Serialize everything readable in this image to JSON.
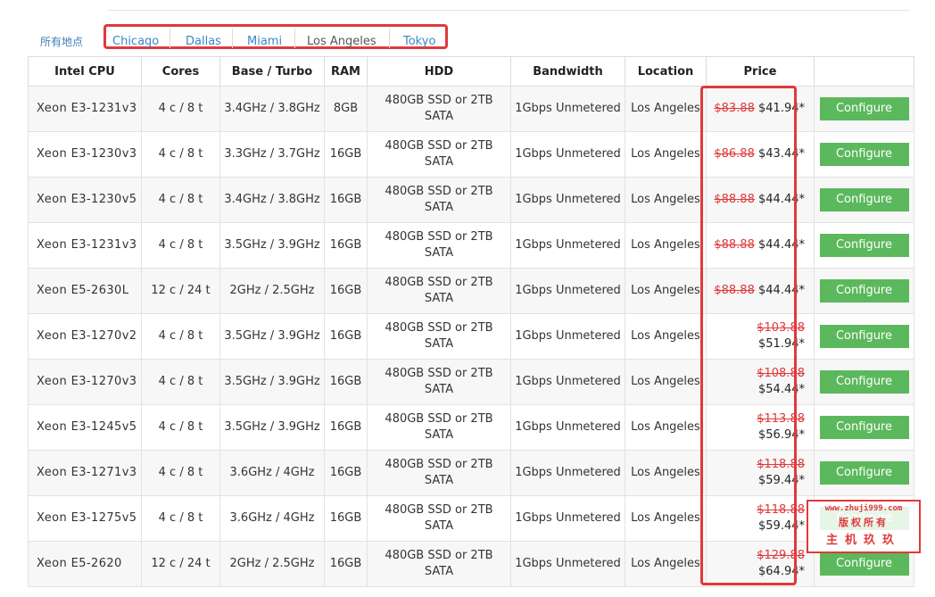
{
  "filters": {
    "all_label": "所有地点",
    "tabs": [
      {
        "label": "Chicago",
        "active": false
      },
      {
        "label": "Dallas",
        "active": false
      },
      {
        "label": "Miami",
        "active": false
      },
      {
        "label": "Los Angeles",
        "active": true
      },
      {
        "label": "Tokyo",
        "active": false
      }
    ]
  },
  "table": {
    "headers": [
      "Intel CPU",
      "Cores",
      "Base / Turbo",
      "RAM",
      "HDD",
      "Bandwidth",
      "Location",
      "Price",
      ""
    ],
    "configure_label": "Configure",
    "rows": [
      {
        "cpu": "Xeon E3-1231v3",
        "cores": "4 c / 8 t",
        "freq": "3.4GHz / 3.8GHz",
        "ram": "8GB",
        "hdd": "480GB SSD or 2TB SATA",
        "bw": "1Gbps Unmetered",
        "loc": "Los Angeles",
        "old_price": "$83.88",
        "new_price": "$41.94*"
      },
      {
        "cpu": "Xeon E3-1230v3",
        "cores": "4 c / 8 t",
        "freq": "3.3GHz / 3.7GHz",
        "ram": "16GB",
        "hdd": "480GB SSD or 2TB SATA",
        "bw": "1Gbps Unmetered",
        "loc": "Los Angeles",
        "old_price": "$86.88",
        "new_price": "$43.44*"
      },
      {
        "cpu": "Xeon E3-1230v5",
        "cores": "4 c / 8 t",
        "freq": "3.4GHz / 3.8GHz",
        "ram": "16GB",
        "hdd": "480GB SSD or 2TB SATA",
        "bw": "1Gbps Unmetered",
        "loc": "Los Angeles",
        "old_price": "$88.88",
        "new_price": "$44.44*"
      },
      {
        "cpu": "Xeon E3-1231v3",
        "cores": "4 c / 8 t",
        "freq": "3.5GHz / 3.9GHz",
        "ram": "16GB",
        "hdd": "480GB SSD or 2TB SATA",
        "bw": "1Gbps Unmetered",
        "loc": "Los Angeles",
        "old_price": "$88.88",
        "new_price": "$44.44*"
      },
      {
        "cpu": "Xeon E5-2630L",
        "cores": "12 c / 24 t",
        "freq": "2GHz / 2.5GHz",
        "ram": "16GB",
        "hdd": "480GB SSD or 2TB SATA",
        "bw": "1Gbps Unmetered",
        "loc": "Los Angeles",
        "old_price": "$88.88",
        "new_price": "$44.44*"
      },
      {
        "cpu": "Xeon E3-1270v2",
        "cores": "4 c / 8 t",
        "freq": "3.5GHz / 3.9GHz",
        "ram": "16GB",
        "hdd": "480GB SSD or 2TB SATA",
        "bw": "1Gbps Unmetered",
        "loc": "Los Angeles",
        "old_price": "$103.88",
        "new_price": "$51.94*"
      },
      {
        "cpu": "Xeon E3-1270v3",
        "cores": "4 c / 8 t",
        "freq": "3.5GHz / 3.9GHz",
        "ram": "16GB",
        "hdd": "480GB SSD or 2TB SATA",
        "bw": "1Gbps Unmetered",
        "loc": "Los Angeles",
        "old_price": "$108.88",
        "new_price": "$54.44*"
      },
      {
        "cpu": "Xeon E3-1245v5",
        "cores": "4 c / 8 t",
        "freq": "3.5GHz / 3.9GHz",
        "ram": "16GB",
        "hdd": "480GB SSD or 2TB SATA",
        "bw": "1Gbps Unmetered",
        "loc": "Los Angeles",
        "old_price": "$113.88",
        "new_price": "$56.94*"
      },
      {
        "cpu": "Xeon E3-1271v3",
        "cores": "4 c / 8 t",
        "freq": "3.6GHz / 4GHz",
        "ram": "16GB",
        "hdd": "480GB SSD or 2TB SATA",
        "bw": "1Gbps Unmetered",
        "loc": "Los Angeles",
        "old_price": "$118.88",
        "new_price": "$59.44*"
      },
      {
        "cpu": "Xeon E3-1275v5",
        "cores": "4 c / 8 t",
        "freq": "3.6GHz / 4GHz",
        "ram": "16GB",
        "hdd": "480GB SSD or 2TB SATA",
        "bw": "1Gbps Unmetered",
        "loc": "Los Angeles",
        "old_price": "$118.88",
        "new_price": "$59.44*"
      },
      {
        "cpu": "Xeon E5-2620",
        "cores": "12 c / 24 t",
        "freq": "2GHz / 2.5GHz",
        "ram": "16GB",
        "hdd": "480GB SSD or 2TB SATA",
        "bw": "1Gbps Unmetered",
        "loc": "Los Angeles",
        "old_price": "$129.88",
        "new_price": "$64.94*"
      }
    ]
  },
  "watermark": {
    "url": "www.zhuji999.com",
    "line2": "版权所有",
    "line3": "主机玖玖"
  },
  "colors": {
    "accent_red": "#e0393b",
    "configure_green": "#5cb85c",
    "link_blue": "#3a86c8"
  }
}
